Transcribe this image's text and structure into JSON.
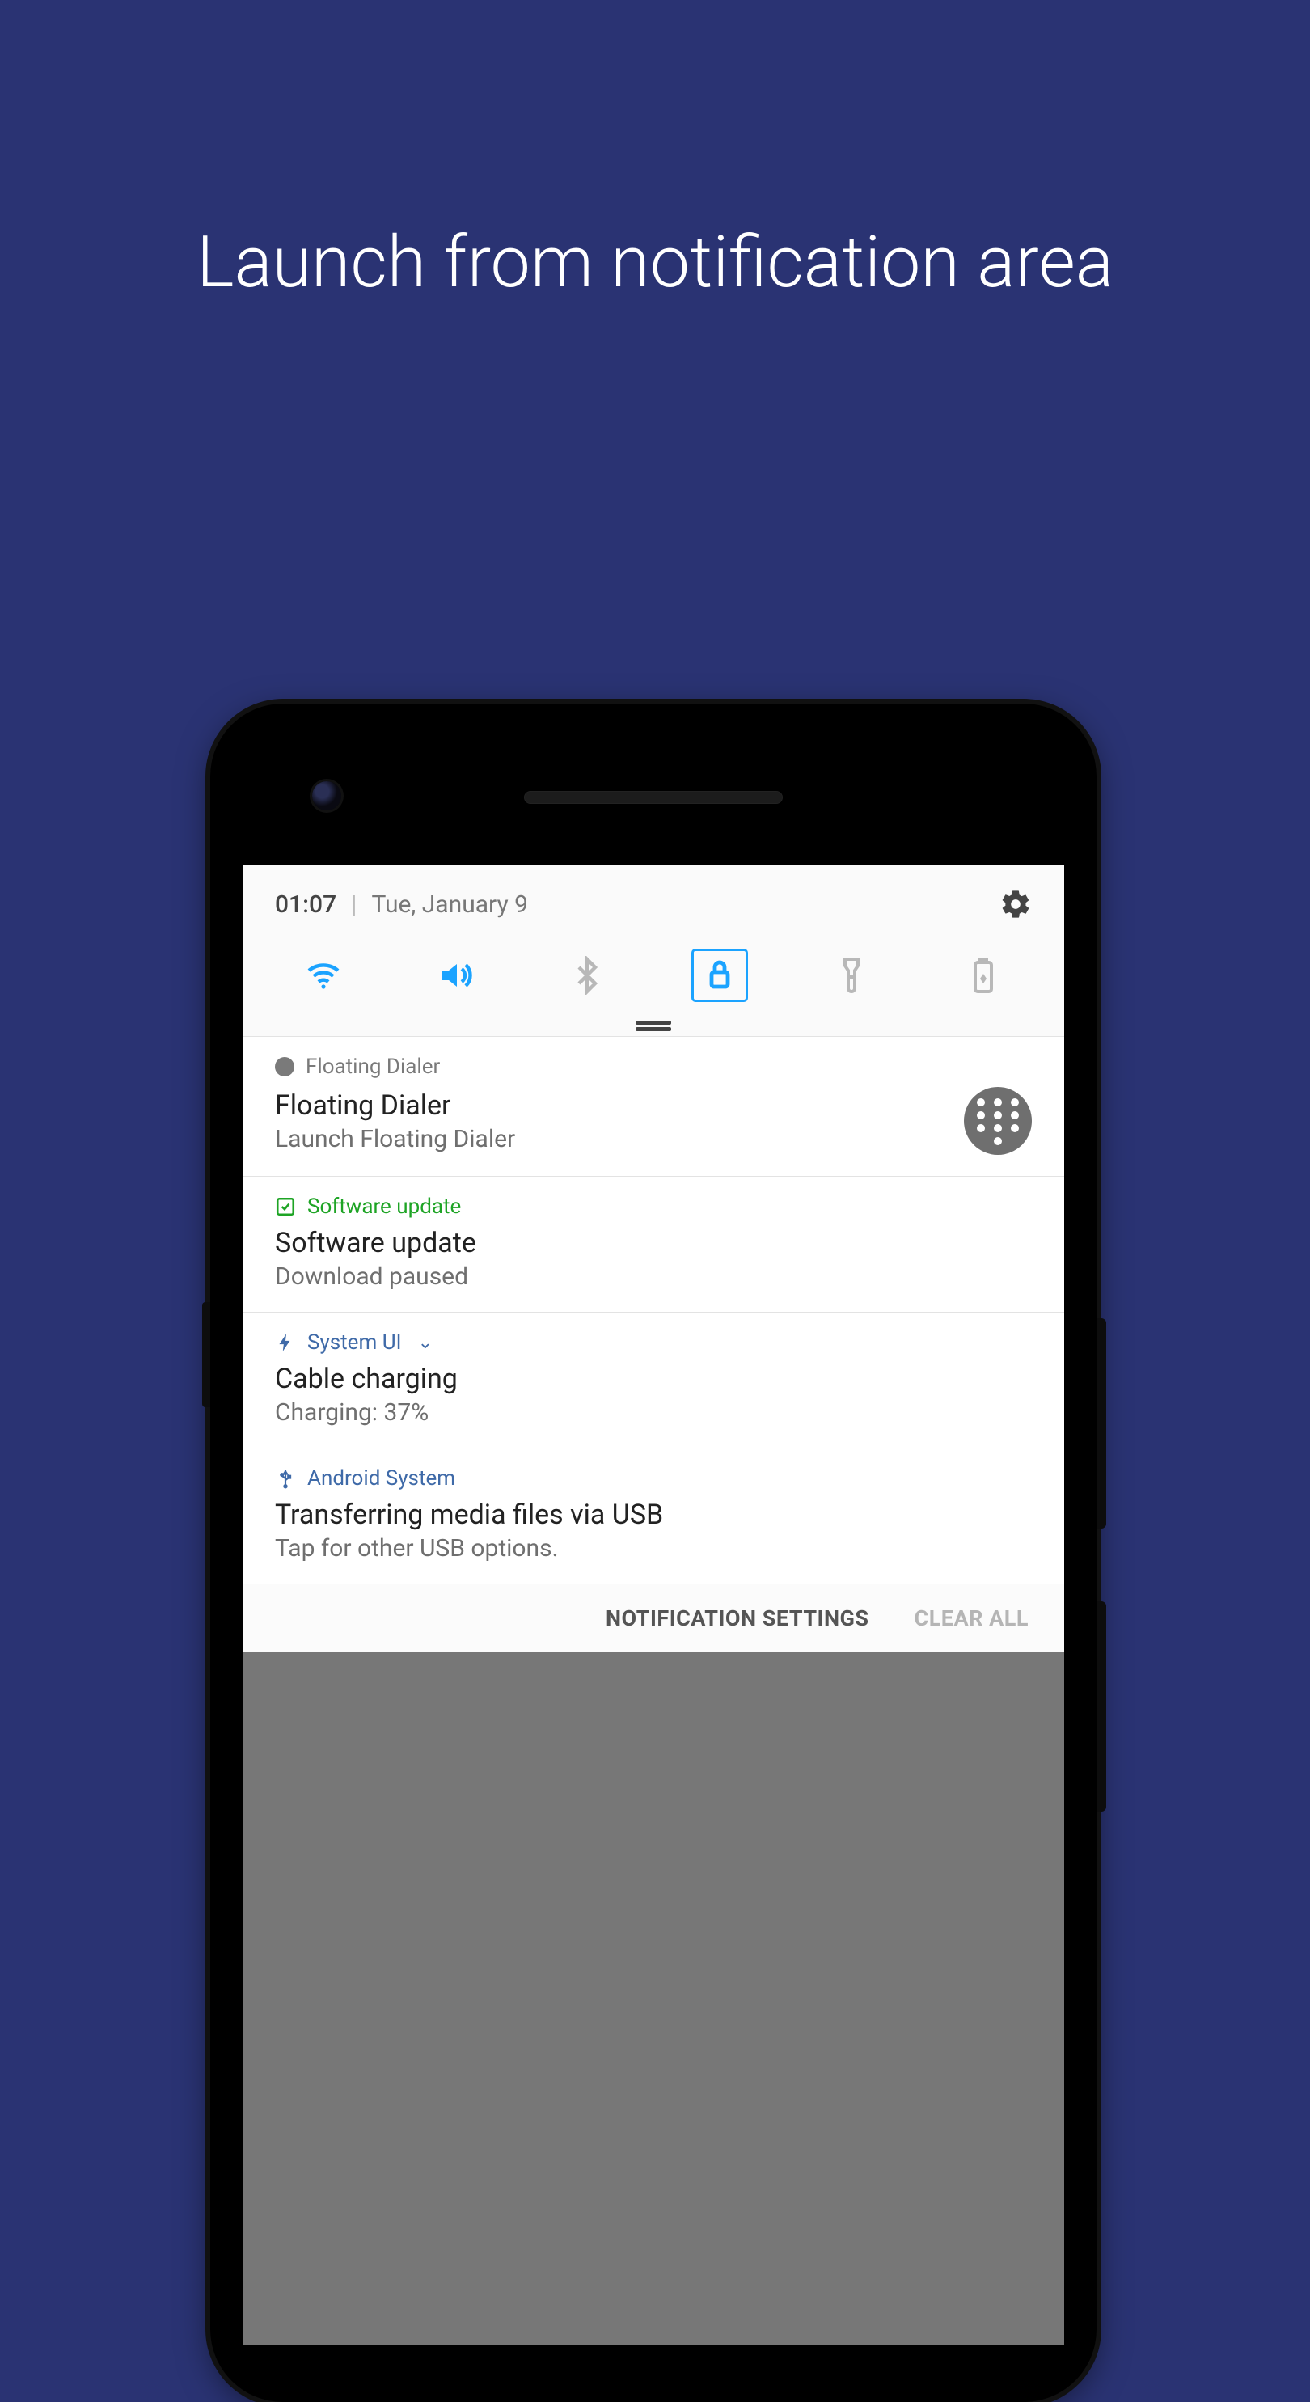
{
  "hero": "Launch from notification area",
  "status": {
    "time": "01:07",
    "date": "Tue, January 9"
  },
  "quick": {
    "wifi": "wifi-icon",
    "sound": "sound-icon",
    "bluetooth": "bluetooth-icon",
    "rotation": "rotation-lock-icon",
    "flashlight": "flashlight-icon",
    "battery": "battery-icon"
  },
  "notifications": [
    {
      "app": "Floating Dialer",
      "title": "Floating Dialer",
      "sub": "Launch Floating Dialer"
    },
    {
      "app": "Software update",
      "title": "Software update",
      "sub": "Download paused"
    },
    {
      "app": "System UI",
      "title": "Cable charging",
      "sub": "Charging: 37%"
    },
    {
      "app": "Android System",
      "title": "Transferring media files via USB",
      "sub": "Tap for other USB options."
    }
  ],
  "footer": {
    "settings": "NOTIFICATION SETTINGS",
    "clear": "CLEAR ALL"
  }
}
